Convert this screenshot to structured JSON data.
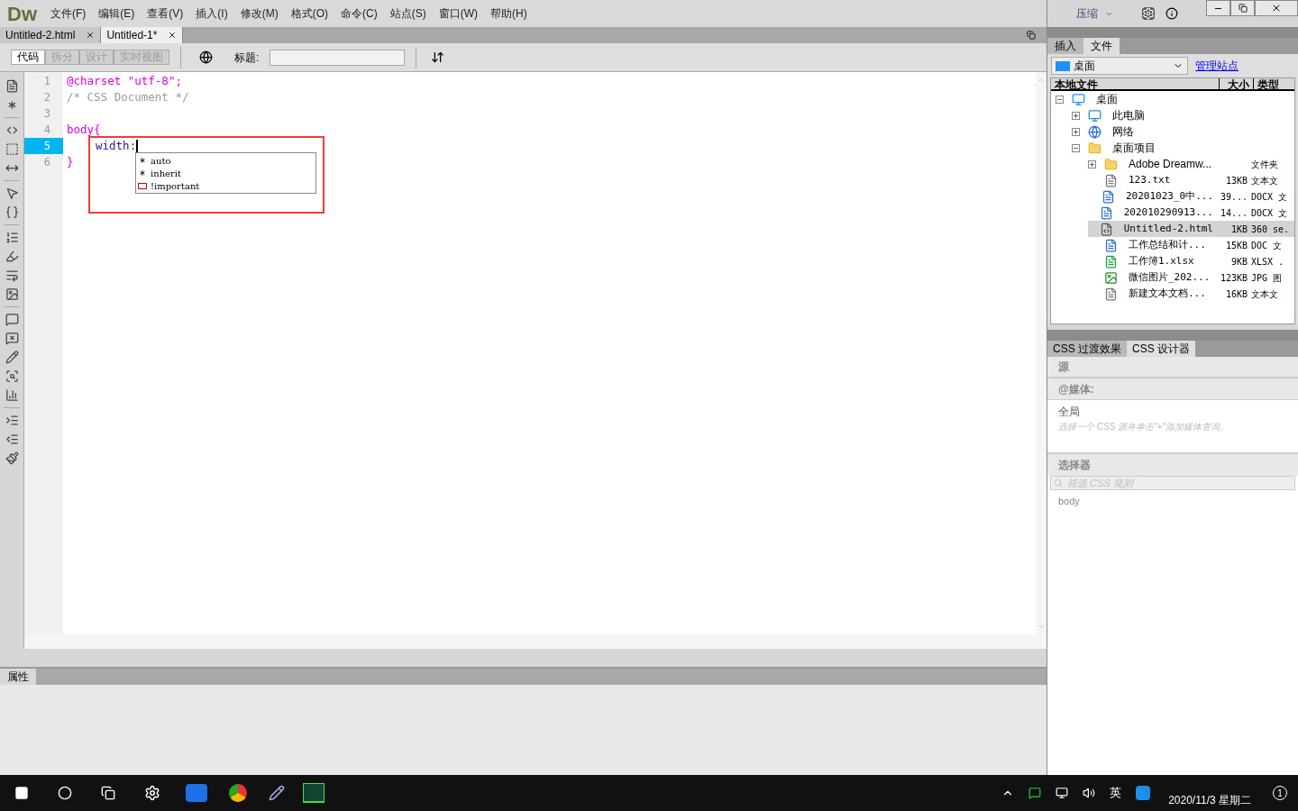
{
  "app": {
    "logo": "Dw",
    "menu": [
      "文件(F)",
      "编辑(E)",
      "查看(V)",
      "插入(I)",
      "修改(M)",
      "格式(O)",
      "命令(C)",
      "站点(S)",
      "窗口(W)",
      "帮助(H)"
    ],
    "workspace": "压缩"
  },
  "doc_tabs": [
    {
      "label": "Untitled-2.html",
      "selected": false
    },
    {
      "label": "Untitled-1*",
      "selected": true
    }
  ],
  "toolbar": {
    "views": [
      {
        "label": "代码",
        "selected": true
      },
      {
        "label": "拆分",
        "selected": false
      },
      {
        "label": "设计",
        "selected": false
      },
      {
        "label": "实时视图",
        "selected": false
      }
    ],
    "title_label": "标题:"
  },
  "code": {
    "lines": [
      {
        "number": "1",
        "text": "@charset \"utf-8\";",
        "kind": "keyword",
        "current": false
      },
      {
        "number": "2",
        "text": "/* CSS Document */",
        "kind": "comment",
        "current": false
      },
      {
        "number": "3",
        "current": false
      },
      {
        "number": "4",
        "text": "body{",
        "kind": "keyword",
        "current": false
      },
      {
        "number": "5",
        "text": "width:",
        "kind": "property",
        "current": true
      },
      {
        "number": "6",
        "text": "}",
        "kind": "keyword",
        "current": false
      }
    ],
    "suggestions": [
      {
        "label": "auto",
        "kind": "value"
      },
      {
        "label": "inherit",
        "kind": "value"
      },
      {
        "label": "!important",
        "kind": "flag"
      }
    ]
  },
  "properties_panel": {
    "title": "属性"
  },
  "files_panel": {
    "tabs": [
      {
        "label": "插入",
        "selected": false
      },
      {
        "label": "文件",
        "selected": true
      }
    ],
    "site": "桌面",
    "manage_link": "管理站点",
    "columns": [
      "本地文件",
      "大小",
      "类型"
    ],
    "tree": [
      {
        "name": "桌面",
        "kind": "desktop",
        "expanded": true,
        "children": [
          {
            "name": "此电脑",
            "kind": "computer",
            "expanded": false
          },
          {
            "name": "网络",
            "kind": "network",
            "expanded": false
          },
          {
            "name": "桌面项目",
            "kind": "folder",
            "expanded": true,
            "children": [
              {
                "name": "Adobe Dreamw...",
                "kind": "folder",
                "expanded": false,
                "type": "文件夹",
                "selected": false
              },
              {
                "name": "123.txt",
                "kind": "text",
                "size": "13KB",
                "type": "文本文",
                "selected": false
              },
              {
                "name": "20201023_0中...",
                "kind": "word",
                "size": "39...",
                "type": "DOCX 文",
                "selected": false
              },
              {
                "name": "202010290913...",
                "kind": "word",
                "size": "14...",
                "type": "DOCX 文",
                "selected": false
              },
              {
                "name": "Untitled-2.html",
                "kind": "html",
                "size": "1KB",
                "type": "360 se.",
                "selected": true
              },
              {
                "name": "工作总结和计...",
                "kind": "word",
                "size": "15KB",
                "type": "DOC 文",
                "selected": false
              },
              {
                "name": "工作簿1.xlsx",
                "kind": "sheet",
                "size": "9KB",
                "type": "XLSX .",
                "selected": false
              },
              {
                "name": "微信图片_202...",
                "kind": "image",
                "size": "123KB",
                "type": "JPG 图",
                "selected": false
              },
              {
                "name": "新建文本文档...",
                "kind": "text",
                "size": "16KB",
                "type": "文本文",
                "selected": false
              }
            ]
          }
        ]
      }
    ]
  },
  "css_panel": {
    "tabs": [
      {
        "label": "CSS 过渡效果",
        "selected": false
      },
      {
        "label": "CSS 设计器",
        "selected": true
      }
    ],
    "sources_title": "源",
    "media_title": "@媒体:",
    "media_item": "全局",
    "media_hint": "选择一个 CSS 源并单击\"+\"添加媒体查询。",
    "selectors_title": "选择器",
    "filter_placeholder": "筛选 CSS 规则",
    "selectors": [
      "body"
    ]
  },
  "taskbar": {
    "ime": "英",
    "date": "2020/11/3 星期二",
    "notifications": "1"
  }
}
